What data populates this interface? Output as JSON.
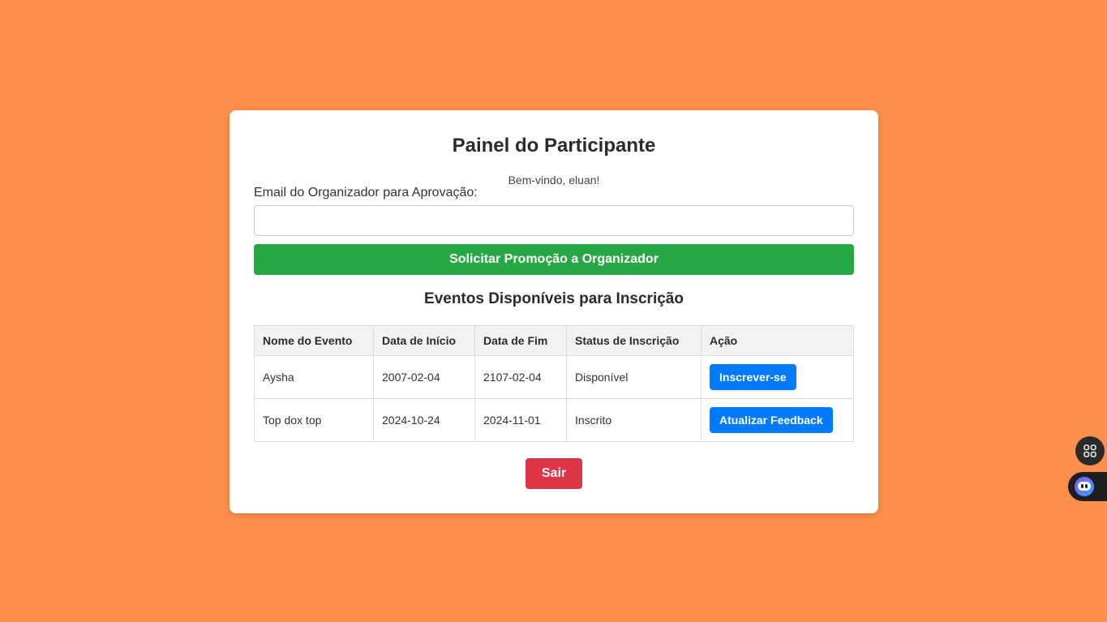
{
  "panel": {
    "title": "Painel do Participante",
    "welcome": "Bem-vindo, eluan!"
  },
  "promotion": {
    "email_label": "Email do Organizador para Aprovação:",
    "email_value": "",
    "email_placeholder": "",
    "button_label": "Solicitar Promoção a Organizador"
  },
  "events": {
    "title": "Eventos Disponíveis para Inscrição",
    "headers": [
      "Nome do Evento",
      "Data de Início",
      "Data de Fim",
      "Status de Inscrição",
      "Ação"
    ],
    "rows": [
      {
        "name": "Aysha",
        "start": "2007-02-04",
        "end": "2107-02-04",
        "status": "Disponível",
        "action": "Inscrever-se"
      },
      {
        "name": "Top dox top",
        "start": "2024-10-24",
        "end": "2024-11-01",
        "status": "Inscrito",
        "action": "Atualizar Feedback"
      }
    ]
  },
  "exit_label": "Sair",
  "floating": {
    "apps_icon": "grid-apps-icon",
    "assistant_icon": "robot-assistant-icon"
  },
  "colors": {
    "background": "#ff8f4c",
    "success": "#28a745",
    "primary": "#007bff",
    "danger": "#dc3545"
  }
}
